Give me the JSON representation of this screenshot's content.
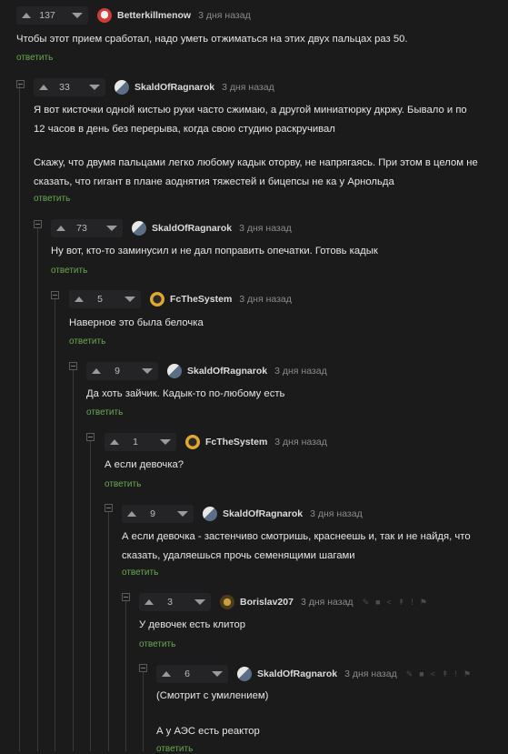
{
  "comments": [
    {
      "rating": "137",
      "author": "Betterkillmenow",
      "time": "3 дня назад",
      "text": [
        "Чтобы этот прием сработал, надо уметь отжиматься на этих двух пальцах раз 50."
      ],
      "reply": "ответить"
    },
    {
      "rating": "33",
      "author": "SkaldOfRagnarok",
      "time": "3 дня назад",
      "text": [
        "Я вот кисточки одной кистью руки часто сжимаю, а другой миниатюрку дкржу. Бывало и по",
        "12 часов в день без перерыва, когда свою студию раскручивал",
        "",
        "Скажу, что двумя пальцами легко любому кадык оторву, не напрягаясь. При этом в целом не",
        "сказать, что гигант в плане аоднятия тяжестей и бицепсы не ка у Арнольда"
      ],
      "reply": "ответить"
    },
    {
      "rating": "73",
      "author": "SkaldOfRagnarok",
      "time": "3 дня назад",
      "text": [
        "Ну вот, кто-то заминусил и не дал поправить опечатки. Готовь кадык"
      ],
      "reply": "ответить"
    },
    {
      "rating": "5",
      "author": "FcTheSystem",
      "time": "3 дня назад",
      "text": [
        "Наверное это была белочка"
      ],
      "reply": "ответить"
    },
    {
      "rating": "9",
      "author": "SkaldOfRagnarok",
      "time": "3 дня назад",
      "text": [
        "Да хоть зайчик. Кадык-то по-любому есть"
      ],
      "reply": "ответить"
    },
    {
      "rating": "1",
      "author": "FcTheSystem",
      "time": "3 дня назад",
      "text": [
        "А если девочка?"
      ],
      "reply": "ответить"
    },
    {
      "rating": "9",
      "author": "SkaldOfRagnarok",
      "time": "3 дня назад",
      "text": [
        "А если девочка - застенчиво смотришь, краснеешь и, так и не найдя, что",
        "сказать, удаляешься прочь семенящими шагами"
      ],
      "reply": "ответить"
    },
    {
      "rating": "3",
      "author": "Borislav207",
      "time": "3 дня назад",
      "text": [
        "У девочек есть клитор"
      ],
      "reply": "ответить"
    },
    {
      "rating": "6",
      "author": "SkaldOfRagnarok",
      "time": "3 дня назад",
      "text": [
        "(Смотрит с умилением)",
        "",
        "А у АЭС есть реактор"
      ],
      "reply": "ответить"
    }
  ],
  "icons": {
    "upvote": "arrow-up-icon",
    "downvote": "arrow-down-icon",
    "collapse": "collapse-thread-icon",
    "edit": "pencil-icon",
    "save": "save-icon",
    "share": "share-icon",
    "pin": "pin-icon",
    "report": "report-flag-icon"
  }
}
